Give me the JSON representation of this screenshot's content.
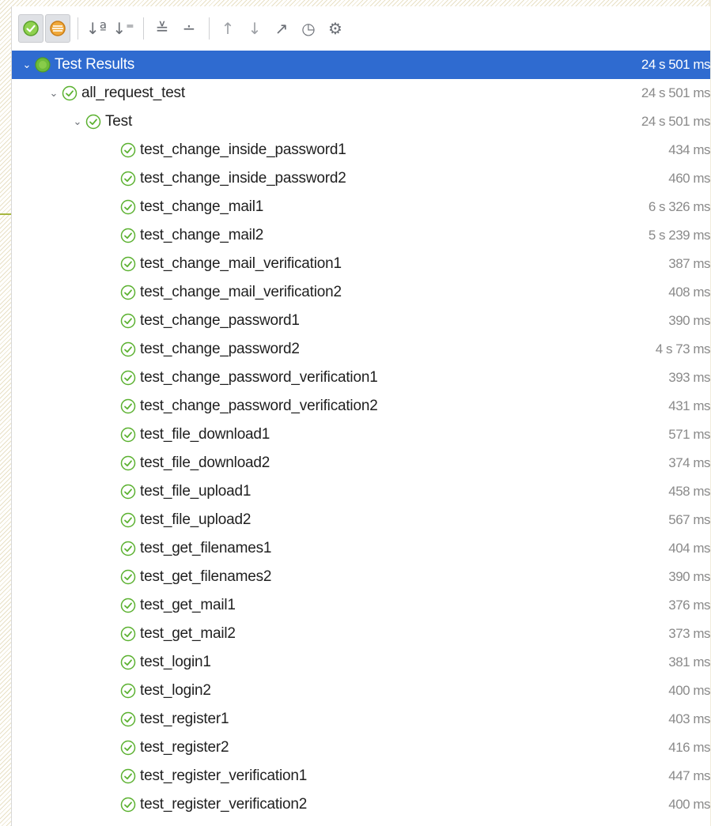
{
  "colors": {
    "selection": "#2f6bd0",
    "pass_green": "#6dbb3a",
    "time_text": "#8a8a8a"
  },
  "toolbar": {
    "buttons": [
      {
        "name": "show-passed-icon",
        "glyph": "",
        "active": true
      },
      {
        "name": "show-ignored-icon",
        "glyph": "",
        "active": true
      },
      {
        "name": "sort-alphabetically-icon",
        "glyph": "↓ª"
      },
      {
        "name": "sort-by-duration-icon",
        "glyph": "↓⁼"
      },
      {
        "name": "expand-all-icon",
        "glyph": "≚"
      },
      {
        "name": "collapse-all-icon",
        "glyph": "∸"
      },
      {
        "name": "previous-test-icon",
        "glyph": "↑"
      },
      {
        "name": "next-test-icon",
        "glyph": "↓"
      },
      {
        "name": "export-icon",
        "glyph": "↗"
      },
      {
        "name": "test-history-icon",
        "glyph": "◷"
      },
      {
        "name": "settings-icon",
        "glyph": "⚙"
      }
    ]
  },
  "tree": {
    "root": {
      "label": "Test Results",
      "time": "24 s 501 ms"
    },
    "suite": {
      "label": "all_request_test",
      "time": "24 s 501 ms"
    },
    "class": {
      "label": "Test",
      "time": "24 s 501 ms"
    },
    "tests": [
      {
        "label": "test_change_inside_password1",
        "time": "434 ms"
      },
      {
        "label": "test_change_inside_password2",
        "time": "460 ms"
      },
      {
        "label": "test_change_mail1",
        "time": "6 s 326 ms"
      },
      {
        "label": "test_change_mail2",
        "time": "5 s 239 ms"
      },
      {
        "label": "test_change_mail_verification1",
        "time": "387 ms"
      },
      {
        "label": "test_change_mail_verification2",
        "time": "408 ms"
      },
      {
        "label": "test_change_password1",
        "time": "390 ms"
      },
      {
        "label": "test_change_password2",
        "time": "4 s 73 ms"
      },
      {
        "label": "test_change_password_verification1",
        "time": "393 ms"
      },
      {
        "label": "test_change_password_verification2",
        "time": "431 ms"
      },
      {
        "label": "test_file_download1",
        "time": "571 ms"
      },
      {
        "label": "test_file_download2",
        "time": "374 ms"
      },
      {
        "label": "test_file_upload1",
        "time": "458 ms"
      },
      {
        "label": "test_file_upload2",
        "time": "567 ms"
      },
      {
        "label": "test_get_filenames1",
        "time": "404 ms"
      },
      {
        "label": "test_get_filenames2",
        "time": "390 ms"
      },
      {
        "label": "test_get_mail1",
        "time": "376 ms"
      },
      {
        "label": "test_get_mail2",
        "time": "373 ms"
      },
      {
        "label": "test_login1",
        "time": "381 ms"
      },
      {
        "label": "test_login2",
        "time": "400 ms"
      },
      {
        "label": "test_register1",
        "time": "403 ms"
      },
      {
        "label": "test_register2",
        "time": "416 ms"
      },
      {
        "label": "test_register_verification1",
        "time": "447 ms"
      },
      {
        "label": "test_register_verification2",
        "time": "400 ms"
      }
    ]
  }
}
